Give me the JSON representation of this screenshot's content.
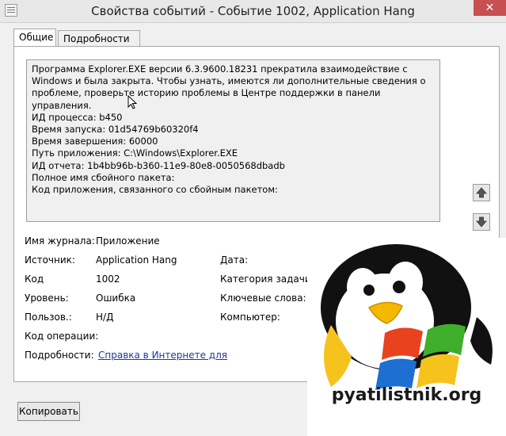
{
  "window": {
    "title": "Свойства событий - Событие 1002, Application Hang",
    "close_glyph": "✕"
  },
  "tabs": [
    {
      "label": "Общие",
      "active": true
    },
    {
      "label": "Подробности",
      "active": false
    }
  ],
  "description": {
    "paragraph": "Программа Explorer.EXE версии 6.3.9600.18231 прекратила взаимодействие с Windows и была закрыта. Чтобы узнать, имеются ли дополнительные сведения о проблеме, проверьте историю проблемы в Центре поддержки в панели управления.",
    "lines": [
      "ИД процесса: b450",
      "Время запуска: 01d54769b60320f4",
      "Время завершения: 60000",
      "Путь приложения: C:\\Windows\\Explorer.EXE",
      "ИД отчета: 1b4bb96b-b360-11e9-80e8-0050568dbadb",
      "Полное имя сбойного пакета:",
      "Код приложения, связанного со сбойным пакетом:"
    ]
  },
  "properties": {
    "log_label": "Имя журнала:",
    "log_value": "Приложение",
    "source_label": "Источник:",
    "source_value": "Application Hang",
    "code_label": "Код",
    "code_value": "1002",
    "level_label": "Уровень:",
    "level_value": "Ошибка",
    "user_label": "Пользов.:",
    "user_value": "Н/Д",
    "opcode_label": "Код операции:",
    "details_label": "Подробности:",
    "details_link": "Справка в Интернете для",
    "date_label": "Дата:",
    "task_label": "Категория задачи:",
    "keywords_label": "Ключевые слова:",
    "computer_label": "Компьютер:"
  },
  "buttons": {
    "copy_label": "Копировать"
  },
  "watermark": {
    "text": "pyatilistnik.org"
  },
  "colors": {
    "close": "#c75050",
    "link": "#1a3a9c",
    "flag_red": "#e8421f",
    "flag_green": "#3fae2a",
    "flag_blue": "#1d6fd1",
    "flag_yellow": "#f6c21c",
    "penguin_beak": "#f5b800"
  }
}
